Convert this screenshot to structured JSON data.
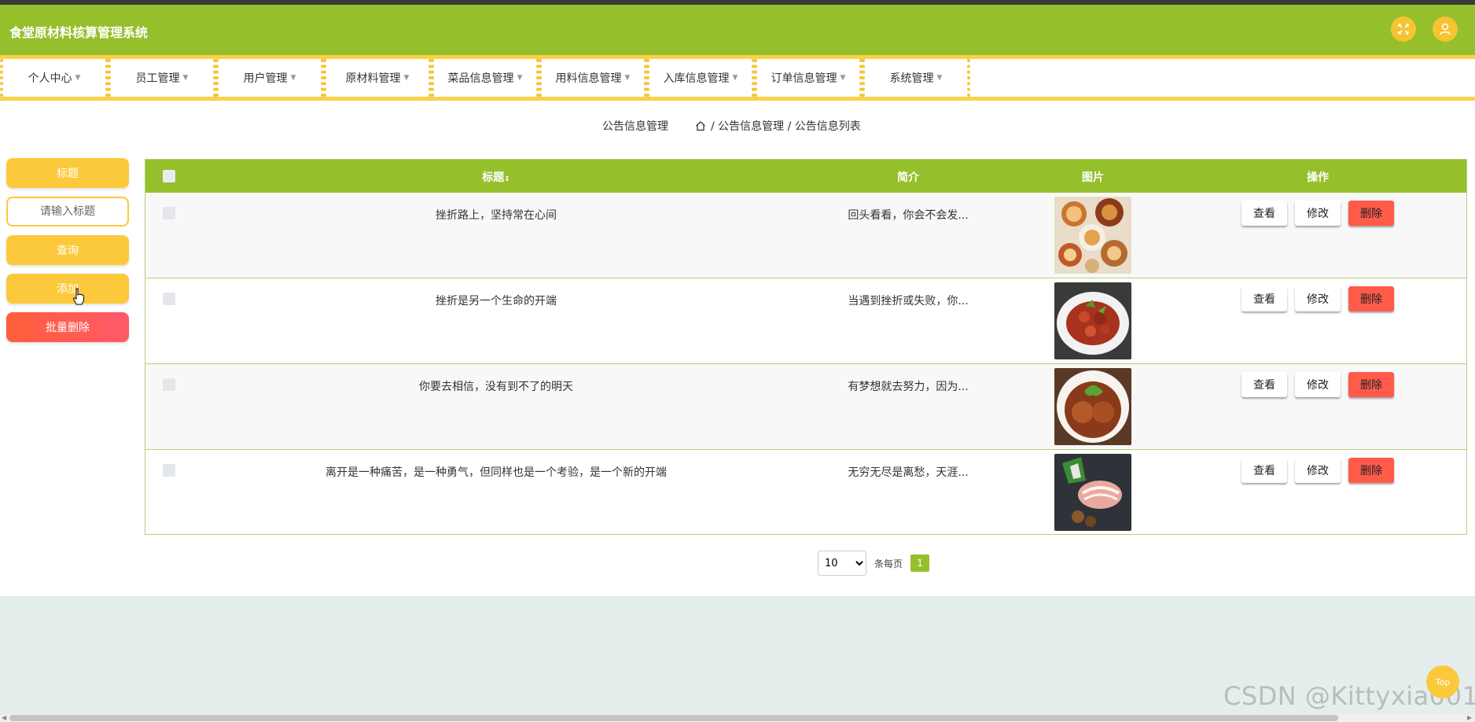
{
  "app": {
    "title": "食堂原材料核算管理系统"
  },
  "header_icons": [
    "fullscreen-icon",
    "user-icon"
  ],
  "nav": [
    {
      "label": "个人中心"
    },
    {
      "label": "员工管理"
    },
    {
      "label": "用户管理"
    },
    {
      "label": "原材料管理"
    },
    {
      "label": "菜品信息管理"
    },
    {
      "label": "用料信息管理"
    },
    {
      "label": "入库信息管理"
    },
    {
      "label": "订单信息管理"
    },
    {
      "label": "系统管理"
    }
  ],
  "breadcrumb": {
    "page_title": "公告信息管理",
    "path": "/ 公告信息管理 / 公告信息列表"
  },
  "sidebar": {
    "filter_label": "标题",
    "search_placeholder": "请输入标题",
    "query_button": "查询",
    "add_button": "添加",
    "batch_delete_button": "批量删除"
  },
  "table": {
    "headers": {
      "title": "标题",
      "summary": "简介",
      "image": "图片",
      "actions": "操作"
    },
    "rows": [
      {
        "title": "挫折路上，坚持常在心间",
        "summary": "回头看看，你会不会发...",
        "image": "dim-sum-dishes"
      },
      {
        "title": "挫折是另一个生命的开端",
        "summary": "当遇到挫折或失败，你...",
        "image": "braised-meat-dish"
      },
      {
        "title": "你要去相信，没有到不了的明天",
        "summary": "有梦想就去努力，因为...",
        "image": "braised-meatballs"
      },
      {
        "title": "离开是一种痛苦，是一种勇气，但同样也是一个考验，是一个新的开端",
        "summary": "无穷无尽是离愁，天涯...",
        "image": "sliced-meat-platter"
      }
    ],
    "actions": {
      "view": "查看",
      "edit": "修改",
      "delete": "删除"
    }
  },
  "pagination": {
    "page_size": "10",
    "per_page_label": "条每页",
    "current_page": "1"
  },
  "top_button": "Top",
  "watermark": "CSDN @Kittyxia001",
  "colors": {
    "primary_green": "#95c02c",
    "accent_yellow": "#fcc93d",
    "danger_red": "#ff5a4a"
  }
}
